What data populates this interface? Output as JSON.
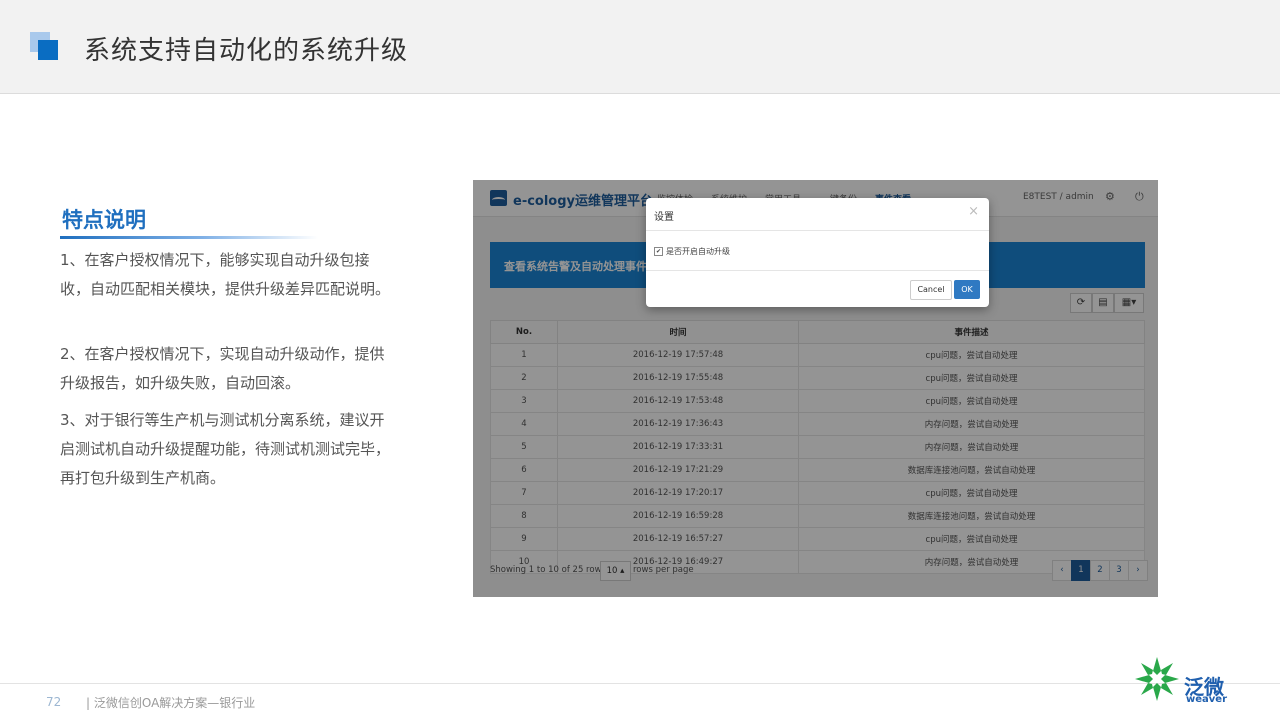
{
  "slide": {
    "title": "系统支持自动化的系统升级",
    "feature_title": "特点说明",
    "paragraphs": [
      "1、在客户授权情况下，能够实现自动升级包接收，自动匹配相关模块，提供升级差异匹配说明。",
      "2、在客户授权情况下，实现自动升级动作，提供升级报告，如升级失败，自动回滚。",
      "3、对于银行等生产机与测试机分离系统，建议开启测试机自动升级提醒功能，待测试机测试完毕，再打包升级到生产机商。"
    ],
    "footer": {
      "page_number": "72",
      "text": "| 泛微信创OA解决方案—银行业"
    },
    "brand": {
      "cn": "泛微",
      "en": "weaver",
      "color": "#1f5fae",
      "mark_color": "#2aa84a"
    }
  },
  "app": {
    "title": "e-cology运维管理平台",
    "nav": [
      "监控体检",
      "系统维护",
      "常用工具",
      "一键备份",
      "事件查看"
    ],
    "user": "E8TEST / admin",
    "panel_title": "查看系统告警及自动处理事件",
    "table": {
      "headers": [
        "No.",
        "时间",
        "事件描述"
      ],
      "rows": [
        [
          "1",
          "2016-12-19 17:57:48",
          "cpu问题，尝试自动处理"
        ],
        [
          "2",
          "2016-12-19 17:55:48",
          "cpu问题，尝试自动处理"
        ],
        [
          "3",
          "2016-12-19 17:53:48",
          "cpu问题，尝试自动处理"
        ],
        [
          "4",
          "2016-12-19 17:36:43",
          "内存问题，尝试自动处理"
        ],
        [
          "5",
          "2016-12-19 17:33:31",
          "内存问题，尝试自动处理"
        ],
        [
          "6",
          "2016-12-19 17:21:29",
          "数据库连接池问题，尝试自动处理"
        ],
        [
          "7",
          "2016-12-19 17:20:17",
          "cpu问题，尝试自动处理"
        ],
        [
          "8",
          "2016-12-19 16:59:28",
          "数据库连接池问题，尝试自动处理"
        ],
        [
          "9",
          "2016-12-19 16:57:27",
          "cpu问题，尝试自动处理"
        ],
        [
          "10",
          "2016-12-19 16:49:27",
          "内存问题，尝试自动处理"
        ]
      ]
    },
    "pagination": {
      "info": "Showing 1 to 10 of 25 rows",
      "page_size": "10 ▴",
      "suffix": "rows per page",
      "pages": [
        "‹",
        "1",
        "2",
        "3",
        "›"
      ],
      "active_page": "1"
    },
    "modal": {
      "title": "设置",
      "close": "×",
      "checkbox_label": "是否开启自动升级",
      "checked": true,
      "cancel": "Cancel",
      "ok": "OK"
    }
  }
}
